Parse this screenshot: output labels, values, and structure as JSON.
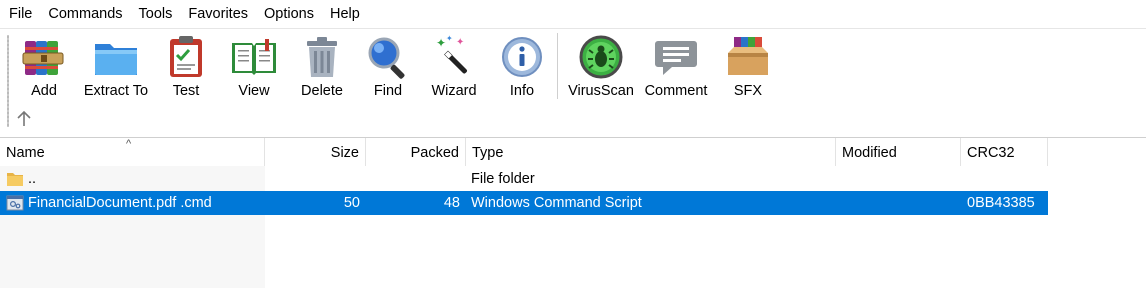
{
  "menu": [
    "File",
    "Commands",
    "Tools",
    "Favorites",
    "Options",
    "Help"
  ],
  "toolbar": {
    "buttons": [
      {
        "label": "Add",
        "icon": "archive-books-icon"
      },
      {
        "label": "Extract To",
        "icon": "folder-icon"
      },
      {
        "label": "Test",
        "icon": "clipboard-check-icon"
      },
      {
        "label": "View",
        "icon": "open-book-icon"
      },
      {
        "label": "Delete",
        "icon": "trash-can-icon"
      },
      {
        "label": "Find",
        "icon": "magnifier-icon"
      },
      {
        "label": "Wizard",
        "icon": "magic-wand-icon"
      },
      {
        "label": "Info",
        "icon": "info-icon"
      },
      {
        "label": "VirusScan",
        "icon": "bug-scan-icon"
      },
      {
        "label": "Comment",
        "icon": "speech-bubble-icon"
      },
      {
        "label": "SFX",
        "icon": "sfx-box-icon"
      }
    ]
  },
  "list": {
    "columns": [
      "Name",
      "Size",
      "Packed",
      "Type",
      "Modified",
      "CRC32"
    ],
    "sort_indicator": "^",
    "rows": [
      {
        "name": "..",
        "size": "",
        "packed": "",
        "type": "File folder",
        "modified": "",
        "crc": "",
        "icon": "folder-icon",
        "selected": false
      },
      {
        "name": "FinancialDocument.pdf .cmd",
        "size": "50",
        "packed": "48",
        "type": "Windows Command Script",
        "modified": "",
        "crc": "0BB43385",
        "icon": "script-file-icon",
        "selected": true
      }
    ]
  },
  "colors": {
    "selection": "#0078d7",
    "header_border": "#e3e3e3"
  }
}
